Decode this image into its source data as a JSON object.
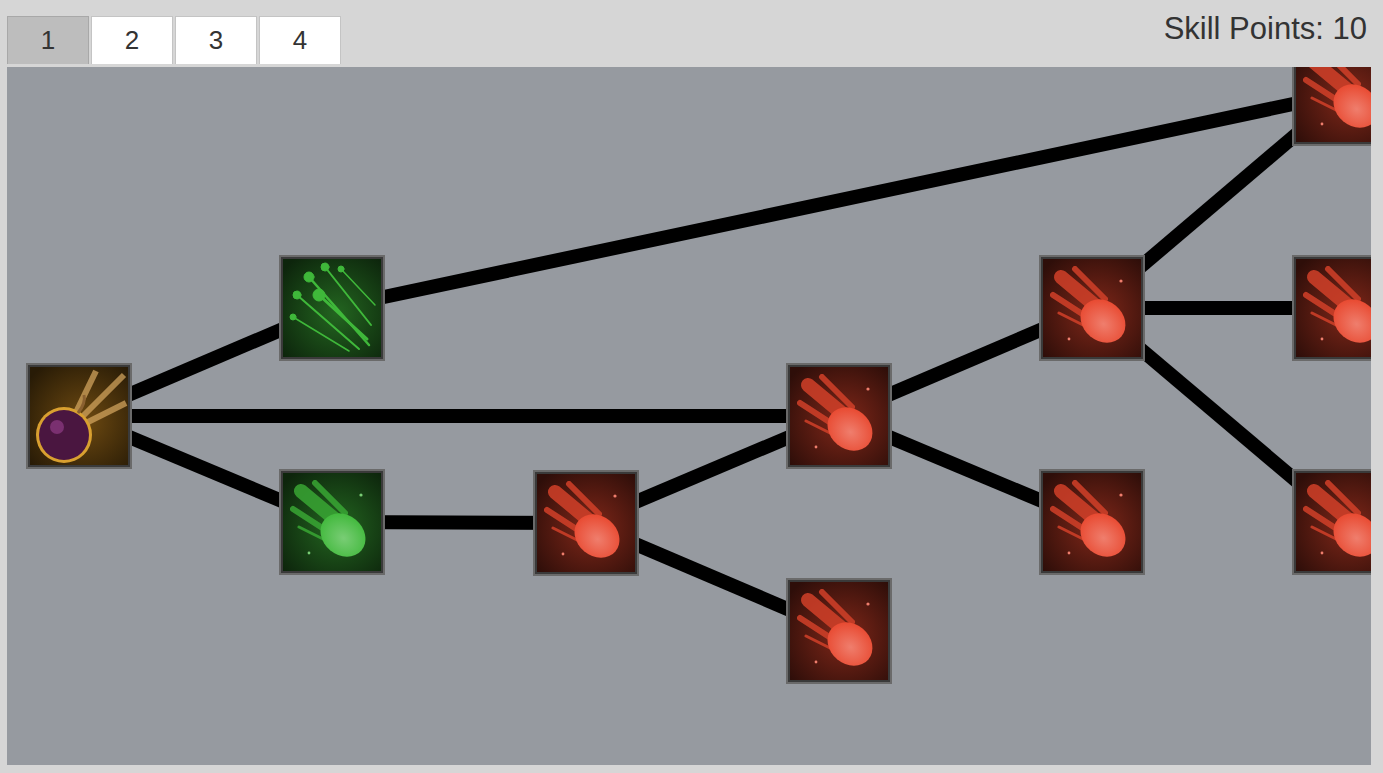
{
  "tabs": [
    {
      "label": "1",
      "selected": true
    },
    {
      "label": "2",
      "selected": false
    },
    {
      "label": "3",
      "selected": false
    },
    {
      "label": "4",
      "selected": false
    }
  ],
  "skill_points": "Skill Points: 10",
  "nodes": [
    {
      "kind": "bomb",
      "color": "#c8861e"
    },
    {
      "kind": "splash",
      "color": "#3fb83a"
    },
    {
      "kind": "meteor",
      "color": "#3fb83a"
    },
    {
      "kind": "meteor",
      "color": "#e8472e"
    },
    {
      "kind": "meteor",
      "color": "#e8472e"
    },
    {
      "kind": "meteor",
      "color": "#e8472e"
    },
    {
      "kind": "meteor",
      "color": "#e8472e"
    },
    {
      "kind": "meteor",
      "color": "#e8472e"
    },
    {
      "kind": "meteor",
      "color": "#e8472e"
    },
    {
      "kind": "meteor",
      "color": "#e8472e"
    },
    {
      "kind": "meteor",
      "color": "#e8472e"
    }
  ],
  "links": [
    {
      "from": 0,
      "to": 1
    },
    {
      "from": 0,
      "to": 4
    },
    {
      "from": 0,
      "to": 2
    },
    {
      "from": 1,
      "to": 8
    },
    {
      "from": 2,
      "to": 3
    },
    {
      "from": 3,
      "to": 4
    },
    {
      "from": 3,
      "to": 5
    },
    {
      "from": 4,
      "to": 6
    },
    {
      "from": 4,
      "to": 7
    },
    {
      "from": 6,
      "to": 8
    },
    {
      "from": 6,
      "to": 9
    },
    {
      "from": 6,
      "to": 10
    }
  ]
}
